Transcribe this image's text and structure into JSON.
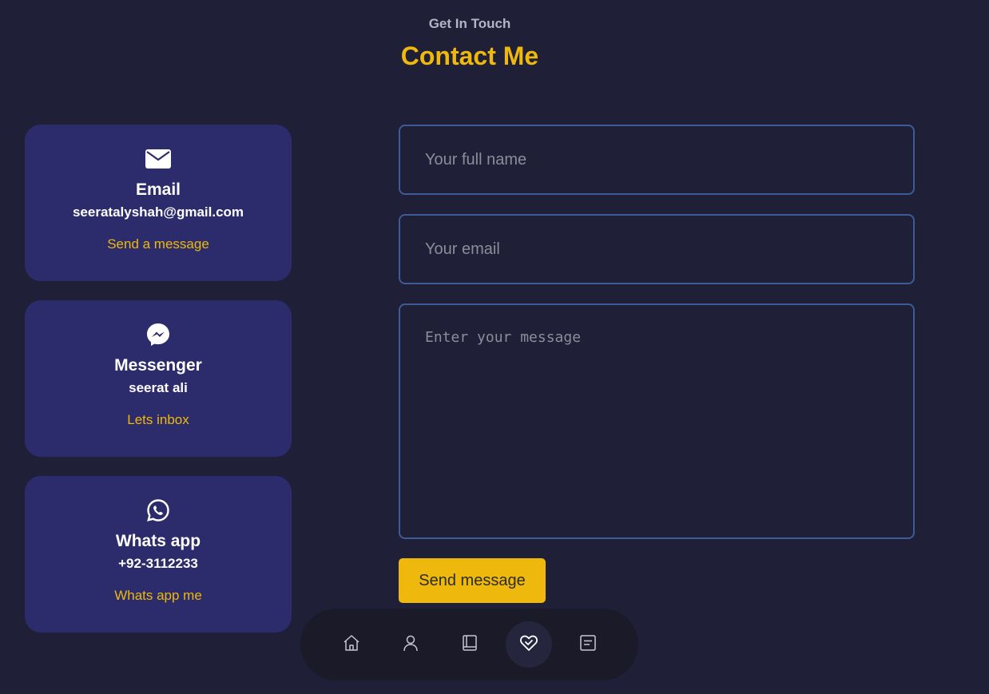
{
  "header": {
    "subtitle": "Get In Touch",
    "title": "Contact Me"
  },
  "contact_cards": [
    {
      "icon": "envelope-icon",
      "title": "Email",
      "value": "seeratalyshah@gmail.com",
      "link_label": "Send a message"
    },
    {
      "icon": "messenger-icon",
      "title": "Messenger",
      "value": "seerat ali",
      "link_label": "Lets inbox"
    },
    {
      "icon": "whatsapp-icon",
      "title": "Whats app",
      "value": "+92-3112233",
      "link_label": "Whats app me"
    }
  ],
  "form": {
    "name_placeholder": "Your full name",
    "email_placeholder": "Your email",
    "message_placeholder": "Enter your message",
    "submit_label": "Send message"
  },
  "nav": {
    "items": [
      "home-icon",
      "user-icon",
      "book-icon",
      "services-icon",
      "message-icon"
    ],
    "active": "services-icon"
  },
  "colors": {
    "background": "#1f1f38",
    "accent": "#eeb90c",
    "card": "#2c2c6c",
    "input_border": "#3b5c95"
  }
}
